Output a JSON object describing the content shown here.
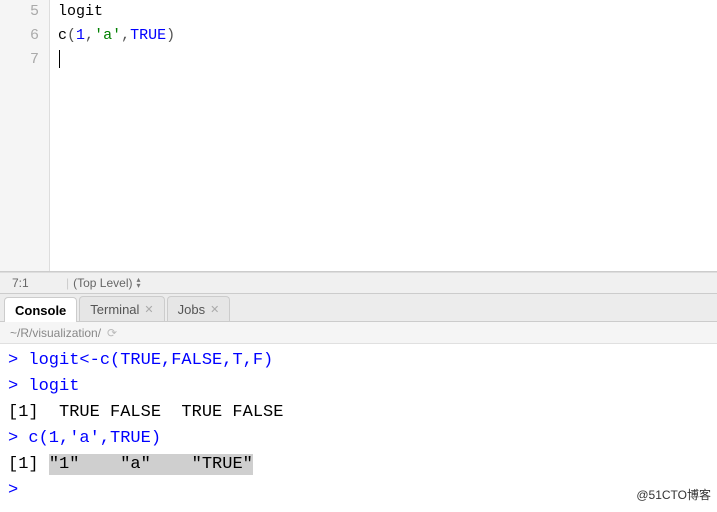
{
  "editor": {
    "lines": [
      {
        "num": "5",
        "tokens": [
          {
            "t": "logit",
            "c": "tok-fn"
          }
        ]
      },
      {
        "num": "6",
        "tokens": [
          {
            "t": "c",
            "c": "tok-fn"
          },
          {
            "t": "(",
            "c": "tok-punc"
          },
          {
            "t": "1",
            "c": "tok-num"
          },
          {
            "t": ",",
            "c": "tok-punc"
          },
          {
            "t": "'a'",
            "c": "tok-str"
          },
          {
            "t": ",",
            "c": "tok-punc"
          },
          {
            "t": "TRUE",
            "c": "tok-kw"
          },
          {
            "t": ")",
            "c": "tok-punc"
          }
        ]
      },
      {
        "num": "7",
        "tokens": [],
        "cursor": true
      }
    ]
  },
  "statusbar": {
    "position": "7:1",
    "scope": "(Top Level)"
  },
  "tabs": [
    {
      "label": "Console",
      "active": true,
      "closable": false
    },
    {
      "label": "Terminal",
      "active": false,
      "closable": true
    },
    {
      "label": "Jobs",
      "active": false,
      "closable": true
    }
  ],
  "pathbar": {
    "path": "~/R/visualization/"
  },
  "console": {
    "lines": [
      {
        "prompt": "> ",
        "cmd": "logit<-c(TRUE,FALSE,T,F)"
      },
      {
        "prompt": "> ",
        "cmd": "logit"
      },
      {
        "out": "[1]  TRUE FALSE  TRUE FALSE"
      },
      {
        "prompt": "> ",
        "cmd": "c(1,'a',TRUE)"
      },
      {
        "out_prefix": "[1] ",
        "out_sel": "\"1\"    \"a\"    \"TRUE\""
      },
      {
        "prompt": ">",
        "cmd": ""
      }
    ]
  },
  "watermark": "@51CTO博客"
}
